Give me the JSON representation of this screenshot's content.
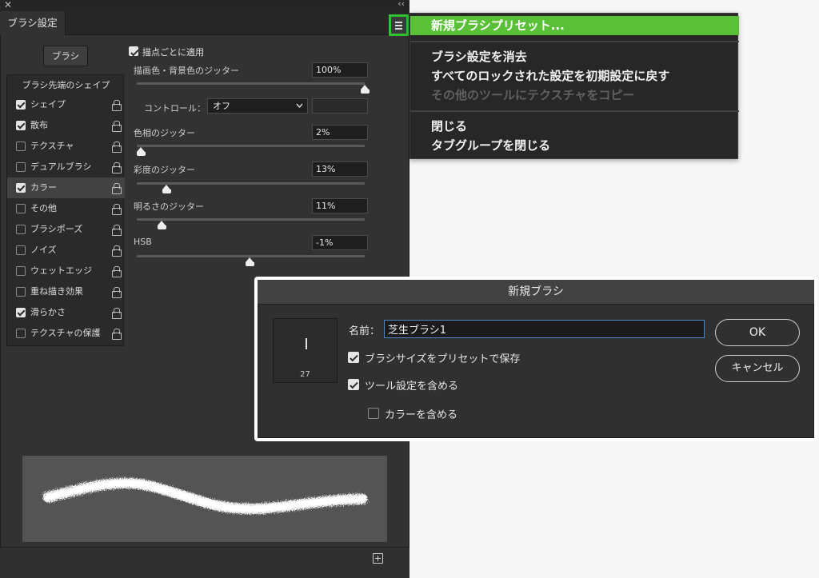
{
  "panel": {
    "tab_title": "ブラシ設定",
    "brush_button": "ブラシ",
    "list_header": "ブラシ先端のシェイプ",
    "items": [
      {
        "label": "シェイプ",
        "checked": true,
        "selected": false
      },
      {
        "label": "散布",
        "checked": true,
        "selected": false
      },
      {
        "label": "テクスチャ",
        "checked": false,
        "selected": false
      },
      {
        "label": "デュアルブラシ",
        "checked": false,
        "selected": false
      },
      {
        "label": "カラー",
        "checked": true,
        "selected": true
      },
      {
        "label": "その他",
        "checked": false,
        "selected": false
      },
      {
        "label": "ブラシポーズ",
        "checked": false,
        "selected": false
      },
      {
        "label": "ノイズ",
        "checked": false,
        "selected": false
      },
      {
        "label": "ウェットエッジ",
        "checked": false,
        "selected": false
      },
      {
        "label": "重ね描き効果",
        "checked": false,
        "selected": false
      },
      {
        "label": "滑らかさ",
        "checked": true,
        "selected": false
      },
      {
        "label": "テクスチャの保護",
        "checked": false,
        "selected": false
      }
    ],
    "apply_per_tip": {
      "label": "描点ごとに適用",
      "checked": true
    },
    "fg_bg_jitter": {
      "label": "描画色・背景色のジッター",
      "value": "100%",
      "level": 1.0
    },
    "control": {
      "label": "コントロール：",
      "value": "オフ"
    },
    "hue_jitter": {
      "label": "色相のジッター",
      "value": "2%",
      "level": 0.02
    },
    "saturation_jitter": {
      "label": "彩度のジッター",
      "value": "13%",
      "level": 0.13
    },
    "brightness_jitter": {
      "label": "明るさのジッター",
      "value": "11%",
      "level": 0.11
    },
    "purity": {
      "label": "HSB",
      "value": "-1%",
      "level": 0.495
    }
  },
  "menu": {
    "items": [
      {
        "label": "新規ブラシプリセット...",
        "state": "highlighted"
      },
      {
        "label": "ブラシ設定を消去",
        "state": "normal"
      },
      {
        "label": "すべてのロックされた設定を初期設定に戻す",
        "state": "normal"
      },
      {
        "label": "その他のツールにテクスチャをコピー",
        "state": "disabled"
      },
      {
        "label": "閉じる",
        "state": "normal"
      },
      {
        "label": "タブグループを閉じる",
        "state": "normal"
      }
    ]
  },
  "dialog": {
    "title": "新規ブラシ",
    "thumb_size": "27",
    "name_label": "名前：",
    "name_value": "芝生ブラシ1",
    "save_size": {
      "label": "ブラシサイズをプリセットで保存",
      "checked": true
    },
    "include_tool": {
      "label": "ツール設定を含める",
      "checked": true
    },
    "include_color": {
      "label": "カラーを含める",
      "checked": false
    },
    "ok": "OK",
    "cancel": "キャンセル"
  },
  "colors": {
    "accent": "#59c037",
    "highlight_border": "#31c232",
    "panel_bg": "#323232"
  },
  "icons": {
    "close": "close-icon",
    "collapse": "collapse-icon",
    "menu": "hamburger-menu-icon",
    "lock": "lock-icon",
    "new": "new-brush-icon",
    "dropdown": "chevron-down-icon"
  }
}
